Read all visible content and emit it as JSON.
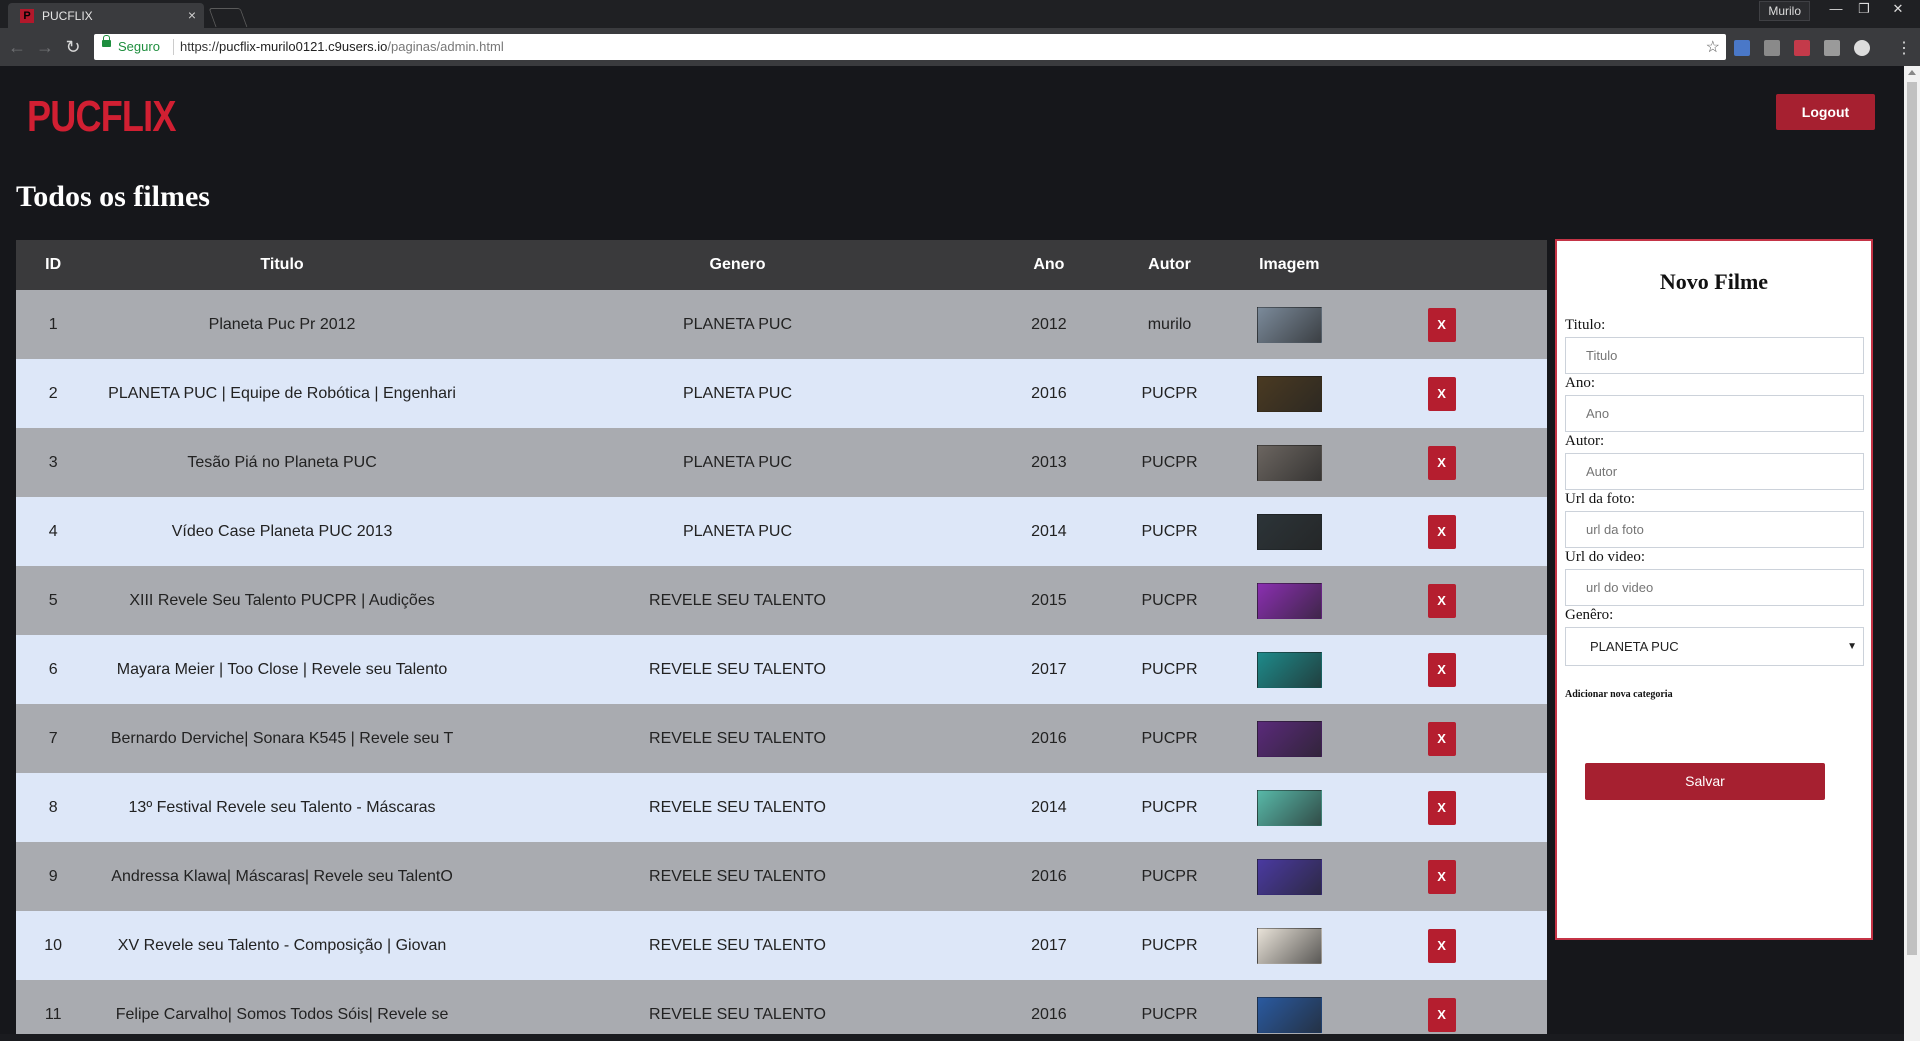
{
  "browser": {
    "tab_title": "PUCFLIX",
    "tab_favicon": "P",
    "tab_close": "×",
    "user_name": "Murilo",
    "window_minimize": "—",
    "window_restore": "❐",
    "window_close": "✕",
    "secure_label": "Seguro",
    "url_scheme": "https://",
    "url_host": "pucflix-murilo0121.c9users.io",
    "url_path": "/paginas/admin.html"
  },
  "header": {
    "logo": "PUCFLIX",
    "logout_label": "Logout"
  },
  "main": {
    "title": "Todos os filmes"
  },
  "table": {
    "headers": [
      "ID",
      "Titulo",
      "Genero",
      "Ano",
      "Autor",
      "Imagem",
      ""
    ],
    "delete_label": "X",
    "rows": [
      {
        "id": "1",
        "titulo": "Planeta Puc Pr 2012",
        "genero": "PLANETA PUC",
        "ano": "2012",
        "autor": "murilo",
        "thumb_color": "#7b8a9a"
      },
      {
        "id": "2",
        "titulo": "PLANETA PUC | Equipe de Robótica | Engenhari",
        "genero": "PLANETA PUC",
        "ano": "2016",
        "autor": "PUCPR",
        "thumb_color": "#4a3a22"
      },
      {
        "id": "3",
        "titulo": "Tesão Piá no Planeta PUC",
        "genero": "PLANETA PUC",
        "ano": "2013",
        "autor": "PUCPR",
        "thumb_color": "#6b6560"
      },
      {
        "id": "4",
        "titulo": "Vídeo Case Planeta PUC 2013",
        "genero": "PLANETA PUC",
        "ano": "2014",
        "autor": "PUCPR",
        "thumb_color": "#2c3438"
      },
      {
        "id": "5",
        "titulo": "XIII Revele Seu Talento PUCPR | Audições",
        "genero": "REVELE SEU TALENTO",
        "ano": "2015",
        "autor": "PUCPR",
        "thumb_color": "#8a2fb0"
      },
      {
        "id": "6",
        "titulo": "Mayara Meier | Too Close | Revele seu Talento",
        "genero": "REVELE SEU TALENTO",
        "ano": "2017",
        "autor": "PUCPR",
        "thumb_color": "#1e8a8a"
      },
      {
        "id": "7",
        "titulo": "Bernardo Derviche| Sonara K545 | Revele seu T",
        "genero": "REVELE SEU TALENTO",
        "ano": "2016",
        "autor": "PUCPR",
        "thumb_color": "#5a2a7a"
      },
      {
        "id": "8",
        "titulo": "13º Festival Revele seu Talento - Máscaras",
        "genero": "REVELE SEU TALENTO",
        "ano": "2014",
        "autor": "PUCPR",
        "thumb_color": "#58b8a8"
      },
      {
        "id": "9",
        "titulo": "Andressa Klawa| Máscaras| Revele seu TalentO",
        "genero": "REVELE SEU TALENTO",
        "ano": "2016",
        "autor": "PUCPR",
        "thumb_color": "#4a3aa0"
      },
      {
        "id": "10",
        "titulo": "XV Revele seu Talento - Composição | Giovan",
        "genero": "REVELE SEU TALENTO",
        "ano": "2017",
        "autor": "PUCPR",
        "thumb_color": "#e8e2d8"
      },
      {
        "id": "11",
        "titulo": "Felipe Carvalho| Somos Todos Sóis| Revele se",
        "genero": "REVELE SEU TALENTO",
        "ano": "2016",
        "autor": "PUCPR",
        "thumb_color": "#2a5aa0"
      }
    ]
  },
  "form": {
    "title": "Novo Filme",
    "titulo_label": "Titulo:",
    "titulo_placeholder": "Titulo",
    "ano_label": "Ano:",
    "ano_placeholder": "Ano",
    "autor_label": "Autor:",
    "autor_placeholder": "Autor",
    "foto_label": "Url da foto:",
    "foto_placeholder": "url da foto",
    "video_label": "Url do video:",
    "video_placeholder": "url do video",
    "genero_label": "Genêro:",
    "genero_selected": "PLANETA PUC",
    "add_category_label": "Adicionar nova categoria",
    "save_label": "Salvar"
  },
  "colors": {
    "brand_red": "#d11f32",
    "button_red": "#a62030",
    "row_odd": "#a9abb0",
    "row_even": "#dde7f8",
    "header_bg": "#3a3a3c",
    "page_bg": "#16171b"
  }
}
